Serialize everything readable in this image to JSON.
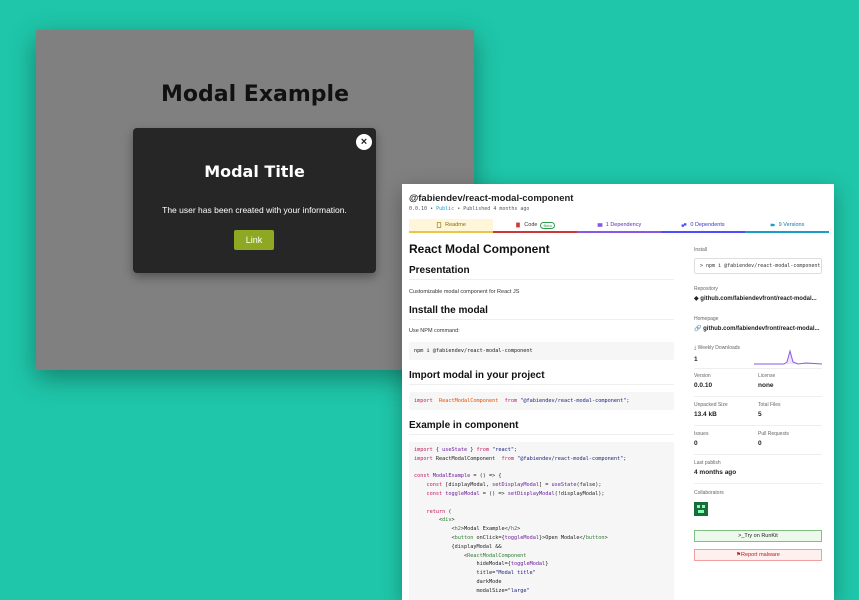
{
  "demo": {
    "title": "Modal Example",
    "modal": {
      "close_icon": "×",
      "title": "Modal Title",
      "text": "The user has been created with your information.",
      "button": "Link"
    }
  },
  "npm": {
    "package_name": "@fabiendev/react-modal-component",
    "version": "0.0.10",
    "sep1": "•",
    "visibility": "Public",
    "sep2": "•",
    "published": "Published 4 months ago",
    "tabs": {
      "readme": "Readme",
      "code": "Code",
      "beta": "Beta",
      "dependency": "1 Dependency",
      "dependents": "0 Dependents",
      "versions": "9 Versions"
    },
    "readme": {
      "title": "React Modal Component",
      "presentation_heading": "Presentation",
      "presentation_text": "Customizable modal component for React JS",
      "install_heading": "Install the modal",
      "install_text": "Use NPM command:",
      "install_cmd": "npm i @fabiendev/react-modal-component",
      "import_heading": "Import modal in your project",
      "import_kw": "import",
      "import_comp": "ReactModalComponent",
      "import_from": "from",
      "import_str": "\"@fabiendev/react-modal-component\";",
      "example_heading": "Example in component",
      "example_lines": [
        "import { useState } from \"react\";",
        "import ReactModalComponent  from \"@fabiendev/react-modal-component\";",
        "",
        "const ModalExample = () => {",
        "    const [displayModal, setDisplayModal] = useState(false);",
        "    const toggleModal = () => setDisplayModal(!displayModal);",
        "",
        "    return (",
        "        <div>",
        "            <h2>Modal Example</h2>",
        "            <button onClick={toggleModal}>Open Modale</button>",
        "            {displayModal &&",
        "                <ReactModalComponent",
        "                    hideModal={toggleModal}",
        "                    title=\"Modal title\"",
        "                    darkMode",
        "                    modalSize=\"large\""
      ]
    },
    "sidebar": {
      "install_label": "Install",
      "install_cmd": "npm i @fabiendev/react-modal-component",
      "install_prompt": ">",
      "repository_label": "Repository",
      "repository": "github.com/fabiendevfront/react-modal...",
      "homepage_label": "Homepage",
      "homepage": "github.com/fabiendevfront/react-modal...",
      "weekly_label": "Weekly Downloads",
      "weekly_value": "1",
      "version_label": "Version",
      "version_value": "0.0.10",
      "license_label": "License",
      "license_value": "none",
      "unpacked_label": "Unpacked Size",
      "unpacked_value": "13.4 kB",
      "total_files_label": "Total Files",
      "total_files_value": "5",
      "issues_label": "Issues",
      "issues_value": "0",
      "pull_label": "Pull Requests",
      "pull_value": "0",
      "last_publish_label": "Last publish",
      "last_publish_value": "4 months ago",
      "collaborators_label": "Collaborators",
      "runkit_button": ">_Try on RunKit",
      "report_button": "Report malware"
    },
    "colors": {
      "accent_green": "#8fa823",
      "npm_red": "#cb3837",
      "purple": "#8957e5",
      "blue": "#1a9ec9"
    }
  }
}
